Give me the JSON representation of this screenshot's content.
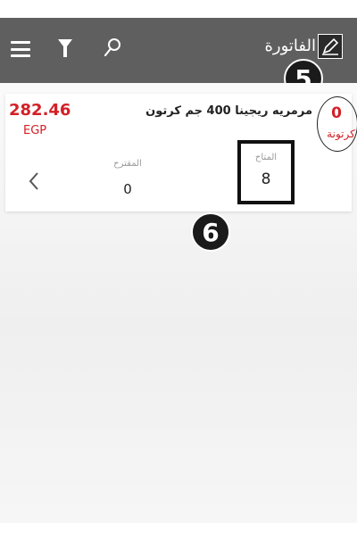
{
  "header": {
    "title": "الفاتورة",
    "icons": [
      "menu-icon",
      "filter-icon",
      "search-icon",
      "edit-invoice-icon"
    ],
    "background_color": "#5f5f5f"
  },
  "annotations": {
    "marker_5": "5",
    "marker_6": "6"
  },
  "item": {
    "quantity": "0",
    "unit": "كرتونة",
    "name": "مرمريه ريجينا 400 جم كرتون",
    "price": "282.46",
    "currency": "EGP",
    "available_label": "المتاح",
    "available_value": "8",
    "suggested_label": "المقترح",
    "suggested_value": "0",
    "accent_color": "#d32027"
  }
}
